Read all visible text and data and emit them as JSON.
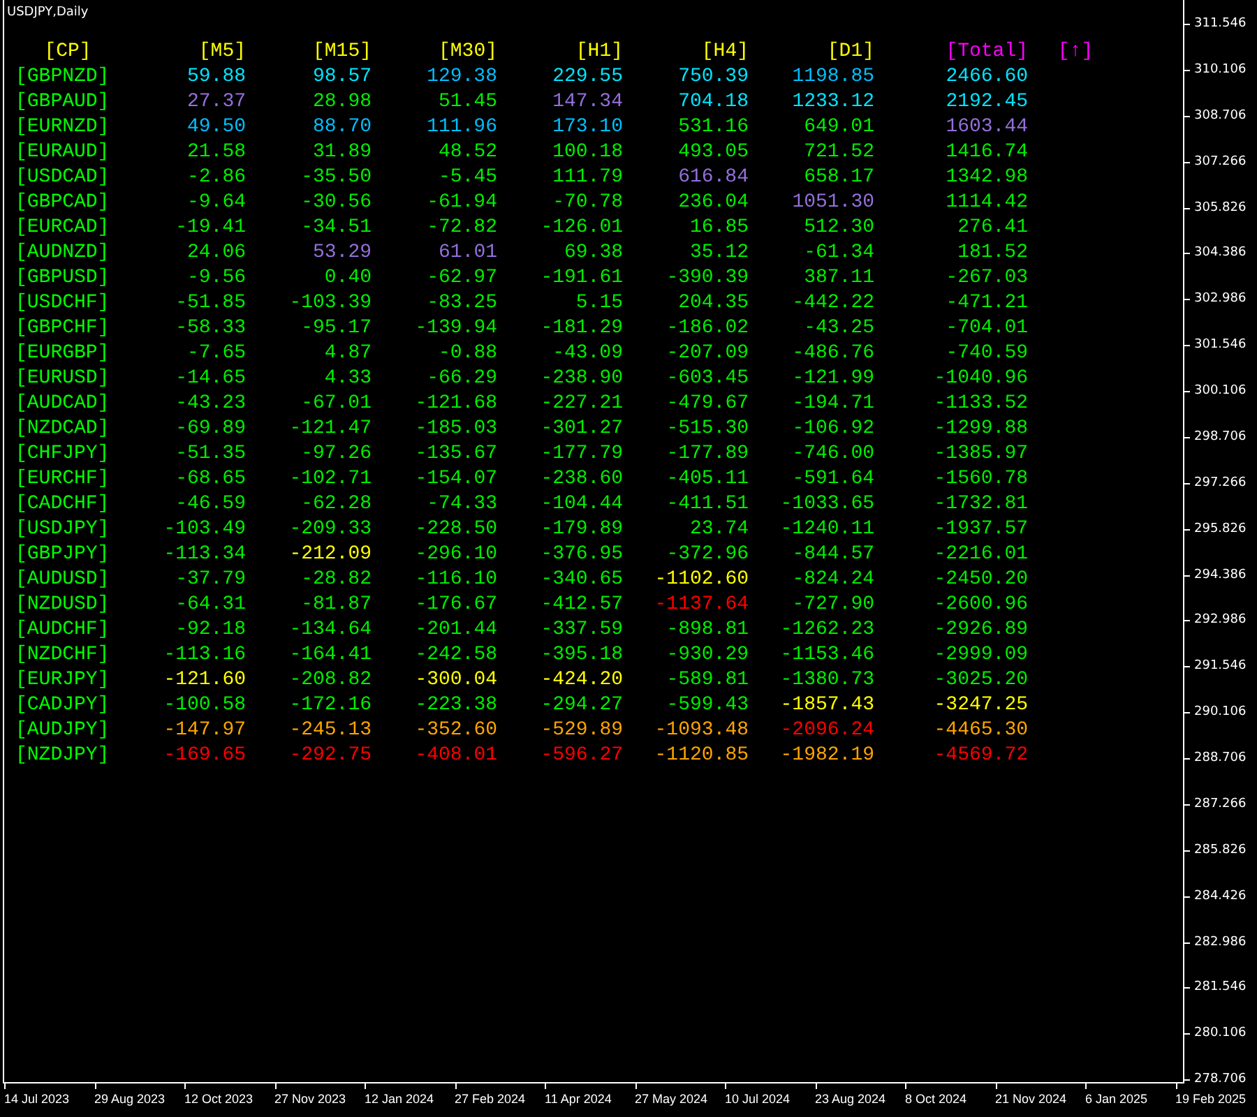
{
  "chart": {
    "title": "USDJPY,Daily"
  },
  "table": {
    "headers": [
      {
        "text": "[CP]",
        "color": "#ffff00"
      },
      {
        "text": "[M5]",
        "color": "#ffff00"
      },
      {
        "text": "[M15]",
        "color": "#ffff00"
      },
      {
        "text": "[M30]",
        "color": "#ffff00"
      },
      {
        "text": "[H1]",
        "color": "#ffff00"
      },
      {
        "text": "[H4]",
        "color": "#ffff00"
      },
      {
        "text": "[D1]",
        "color": "#ffff00"
      },
      {
        "text": "[Total]",
        "color": "#ff00ff"
      },
      {
        "text": "[↑]",
        "color": "#ff00ff"
      }
    ],
    "rows": [
      {
        "pair": "[GBPNZD]",
        "cells": [
          {
            "text": "59.88",
            "color": "#00e5ff"
          },
          {
            "text": "98.57",
            "color": "#00e5ff"
          },
          {
            "text": "129.38",
            "color": "#00bfff"
          },
          {
            "text": "229.55",
            "color": "#00e5ff"
          },
          {
            "text": "750.39",
            "color": "#00e5ff"
          },
          {
            "text": "1198.85",
            "color": "#00bfff"
          },
          {
            "text": "2466.60",
            "color": "#00e5ff"
          }
        ]
      },
      {
        "pair": "[GBPAUD]",
        "cells": [
          {
            "text": "27.37",
            "color": "#9370db"
          },
          {
            "text": "28.98",
            "color": "#00ee00"
          },
          {
            "text": "51.45",
            "color": "#00ee00"
          },
          {
            "text": "147.34",
            "color": "#9370db"
          },
          {
            "text": "704.18",
            "color": "#00e5ff"
          },
          {
            "text": "1233.12",
            "color": "#00e5ff"
          },
          {
            "text": "2192.45",
            "color": "#00e5ff"
          }
        ]
      },
      {
        "pair": "[EURNZD]",
        "cells": [
          {
            "text": "49.50",
            "color": "#00bfff"
          },
          {
            "text": "88.70",
            "color": "#00bfff"
          },
          {
            "text": "111.96",
            "color": "#00bfff"
          },
          {
            "text": "173.10",
            "color": "#00bfff"
          },
          {
            "text": "531.16",
            "color": "#00ee00"
          },
          {
            "text": "649.01",
            "color": "#00ee00"
          },
          {
            "text": "1603.44",
            "color": "#9370db"
          }
        ]
      },
      {
        "pair": "[EURAUD]",
        "cells": [
          {
            "text": "21.58",
            "color": "#00ee00"
          },
          {
            "text": "31.89",
            "color": "#00ee00"
          },
          {
            "text": "48.52",
            "color": "#00ee00"
          },
          {
            "text": "100.18",
            "color": "#00ee00"
          },
          {
            "text": "493.05",
            "color": "#00ee00"
          },
          {
            "text": "721.52",
            "color": "#00ee00"
          },
          {
            "text": "1416.74",
            "color": "#00ee00"
          }
        ]
      },
      {
        "pair": "[USDCAD]",
        "cells": [
          {
            "text": "-2.86",
            "color": "#00ee00"
          },
          {
            "text": "-35.50",
            "color": "#00ee00"
          },
          {
            "text": "-5.45",
            "color": "#00ee00"
          },
          {
            "text": "111.79",
            "color": "#00ee00"
          },
          {
            "text": "616.84",
            "color": "#9370db"
          },
          {
            "text": "658.17",
            "color": "#00ee00"
          },
          {
            "text": "1342.98",
            "color": "#00ee00"
          }
        ]
      },
      {
        "pair": "[GBPCAD]",
        "cells": [
          {
            "text": "-9.64",
            "color": "#00ee00"
          },
          {
            "text": "-30.56",
            "color": "#00ee00"
          },
          {
            "text": "-61.94",
            "color": "#00ee00"
          },
          {
            "text": "-70.78",
            "color": "#00ee00"
          },
          {
            "text": "236.04",
            "color": "#00ee00"
          },
          {
            "text": "1051.30",
            "color": "#9370db"
          },
          {
            "text": "1114.42",
            "color": "#00ee00"
          }
        ]
      },
      {
        "pair": "[EURCAD]",
        "cells": [
          {
            "text": "-19.41",
            "color": "#00ee00"
          },
          {
            "text": "-34.51",
            "color": "#00ee00"
          },
          {
            "text": "-72.82",
            "color": "#00ee00"
          },
          {
            "text": "-126.01",
            "color": "#00ee00"
          },
          {
            "text": "16.85",
            "color": "#00ee00"
          },
          {
            "text": "512.30",
            "color": "#00ee00"
          },
          {
            "text": "276.41",
            "color": "#00ee00"
          }
        ]
      },
      {
        "pair": "[AUDNZD]",
        "cells": [
          {
            "text": "24.06",
            "color": "#00ee00"
          },
          {
            "text": "53.29",
            "color": "#9370db"
          },
          {
            "text": "61.01",
            "color": "#9370db"
          },
          {
            "text": "69.38",
            "color": "#00ee00"
          },
          {
            "text": "35.12",
            "color": "#00ee00"
          },
          {
            "text": "-61.34",
            "color": "#00ee00"
          },
          {
            "text": "181.52",
            "color": "#00ee00"
          }
        ]
      },
      {
        "pair": "[GBPUSD]",
        "cells": [
          {
            "text": "-9.56",
            "color": "#00ee00"
          },
          {
            "text": "0.40",
            "color": "#00ee00"
          },
          {
            "text": "-62.97",
            "color": "#00ee00"
          },
          {
            "text": "-191.61",
            "color": "#00ee00"
          },
          {
            "text": "-390.39",
            "color": "#00ee00"
          },
          {
            "text": "387.11",
            "color": "#00ee00"
          },
          {
            "text": "-267.03",
            "color": "#00ee00"
          }
        ]
      },
      {
        "pair": "[USDCHF]",
        "cells": [
          {
            "text": "-51.85",
            "color": "#00ee00"
          },
          {
            "text": "-103.39",
            "color": "#00ee00"
          },
          {
            "text": "-83.25",
            "color": "#00ee00"
          },
          {
            "text": "5.15",
            "color": "#00ee00"
          },
          {
            "text": "204.35",
            "color": "#00ee00"
          },
          {
            "text": "-442.22",
            "color": "#00ee00"
          },
          {
            "text": "-471.21",
            "color": "#00ee00"
          }
        ]
      },
      {
        "pair": "[GBPCHF]",
        "cells": [
          {
            "text": "-58.33",
            "color": "#00ee00"
          },
          {
            "text": "-95.17",
            "color": "#00ee00"
          },
          {
            "text": "-139.94",
            "color": "#00ee00"
          },
          {
            "text": "-181.29",
            "color": "#00ee00"
          },
          {
            "text": "-186.02",
            "color": "#00ee00"
          },
          {
            "text": "-43.25",
            "color": "#00ee00"
          },
          {
            "text": "-704.01",
            "color": "#00ee00"
          }
        ]
      },
      {
        "pair": "[EURGBP]",
        "cells": [
          {
            "text": "-7.65",
            "color": "#00ee00"
          },
          {
            "text": "4.87",
            "color": "#00ee00"
          },
          {
            "text": "-0.88",
            "color": "#00ee00"
          },
          {
            "text": "-43.09",
            "color": "#00ee00"
          },
          {
            "text": "-207.09",
            "color": "#00ee00"
          },
          {
            "text": "-486.76",
            "color": "#00ee00"
          },
          {
            "text": "-740.59",
            "color": "#00ee00"
          }
        ]
      },
      {
        "pair": "[EURUSD]",
        "cells": [
          {
            "text": "-14.65",
            "color": "#00ee00"
          },
          {
            "text": "4.33",
            "color": "#00ee00"
          },
          {
            "text": "-66.29",
            "color": "#00ee00"
          },
          {
            "text": "-238.90",
            "color": "#00ee00"
          },
          {
            "text": "-603.45",
            "color": "#00ee00"
          },
          {
            "text": "-121.99",
            "color": "#00ee00"
          },
          {
            "text": "-1040.96",
            "color": "#00ee00"
          }
        ]
      },
      {
        "pair": "[AUDCAD]",
        "cells": [
          {
            "text": "-43.23",
            "color": "#00ee00"
          },
          {
            "text": "-67.01",
            "color": "#00ee00"
          },
          {
            "text": "-121.68",
            "color": "#00ee00"
          },
          {
            "text": "-227.21",
            "color": "#00ee00"
          },
          {
            "text": "-479.67",
            "color": "#00ee00"
          },
          {
            "text": "-194.71",
            "color": "#00ee00"
          },
          {
            "text": "-1133.52",
            "color": "#00ee00"
          }
        ]
      },
      {
        "pair": "[NZDCAD]",
        "cells": [
          {
            "text": "-69.89",
            "color": "#00ee00"
          },
          {
            "text": "-121.47",
            "color": "#00ee00"
          },
          {
            "text": "-185.03",
            "color": "#00ee00"
          },
          {
            "text": "-301.27",
            "color": "#00ee00"
          },
          {
            "text": "-515.30",
            "color": "#00ee00"
          },
          {
            "text": "-106.92",
            "color": "#00ee00"
          },
          {
            "text": "-1299.88",
            "color": "#00ee00"
          }
        ]
      },
      {
        "pair": "[CHFJPY]",
        "cells": [
          {
            "text": "-51.35",
            "color": "#00ee00"
          },
          {
            "text": "-97.26",
            "color": "#00ee00"
          },
          {
            "text": "-135.67",
            "color": "#00ee00"
          },
          {
            "text": "-177.79",
            "color": "#00ee00"
          },
          {
            "text": "-177.89",
            "color": "#00ee00"
          },
          {
            "text": "-746.00",
            "color": "#00ee00"
          },
          {
            "text": "-1385.97",
            "color": "#00ee00"
          }
        ]
      },
      {
        "pair": "[EURCHF]",
        "cells": [
          {
            "text": "-68.65",
            "color": "#00ee00"
          },
          {
            "text": "-102.71",
            "color": "#00ee00"
          },
          {
            "text": "-154.07",
            "color": "#00ee00"
          },
          {
            "text": "-238.60",
            "color": "#00ee00"
          },
          {
            "text": "-405.11",
            "color": "#00ee00"
          },
          {
            "text": "-591.64",
            "color": "#00ee00"
          },
          {
            "text": "-1560.78",
            "color": "#00ee00"
          }
        ]
      },
      {
        "pair": "[CADCHF]",
        "cells": [
          {
            "text": "-46.59",
            "color": "#00ee00"
          },
          {
            "text": "-62.28",
            "color": "#00ee00"
          },
          {
            "text": "-74.33",
            "color": "#00ee00"
          },
          {
            "text": "-104.44",
            "color": "#00ee00"
          },
          {
            "text": "-411.51",
            "color": "#00ee00"
          },
          {
            "text": "-1033.65",
            "color": "#00ee00"
          },
          {
            "text": "-1732.81",
            "color": "#00ee00"
          }
        ]
      },
      {
        "pair": "[USDJPY]",
        "cells": [
          {
            "text": "-103.49",
            "color": "#00ee00"
          },
          {
            "text": "-209.33",
            "color": "#00ee00"
          },
          {
            "text": "-228.50",
            "color": "#00ee00"
          },
          {
            "text": "-179.89",
            "color": "#00ee00"
          },
          {
            "text": "23.74",
            "color": "#00ee00"
          },
          {
            "text": "-1240.11",
            "color": "#00ee00"
          },
          {
            "text": "-1937.57",
            "color": "#00ee00"
          }
        ]
      },
      {
        "pair": "[GBPJPY]",
        "cells": [
          {
            "text": "-113.34",
            "color": "#00ee00"
          },
          {
            "text": "-212.09",
            "color": "#ffff00"
          },
          {
            "text": "-296.10",
            "color": "#00ee00"
          },
          {
            "text": "-376.95",
            "color": "#00ee00"
          },
          {
            "text": "-372.96",
            "color": "#00ee00"
          },
          {
            "text": "-844.57",
            "color": "#00ee00"
          },
          {
            "text": "-2216.01",
            "color": "#00ee00"
          }
        ]
      },
      {
        "pair": "[AUDUSD]",
        "cells": [
          {
            "text": "-37.79",
            "color": "#00ee00"
          },
          {
            "text": "-28.82",
            "color": "#00ee00"
          },
          {
            "text": "-116.10",
            "color": "#00ee00"
          },
          {
            "text": "-340.65",
            "color": "#00ee00"
          },
          {
            "text": "-1102.60",
            "color": "#ffff00"
          },
          {
            "text": "-824.24",
            "color": "#00ee00"
          },
          {
            "text": "-2450.20",
            "color": "#00ee00"
          }
        ]
      },
      {
        "pair": "[NZDUSD]",
        "cells": [
          {
            "text": "-64.31",
            "color": "#00ee00"
          },
          {
            "text": "-81.87",
            "color": "#00ee00"
          },
          {
            "text": "-176.67",
            "color": "#00ee00"
          },
          {
            "text": "-412.57",
            "color": "#00ee00"
          },
          {
            "text": "-1137.64",
            "color": "#ff0000"
          },
          {
            "text": "-727.90",
            "color": "#00ee00"
          },
          {
            "text": "-2600.96",
            "color": "#00ee00"
          }
        ]
      },
      {
        "pair": "[AUDCHF]",
        "cells": [
          {
            "text": "-92.18",
            "color": "#00ee00"
          },
          {
            "text": "-134.64",
            "color": "#00ee00"
          },
          {
            "text": "-201.44",
            "color": "#00ee00"
          },
          {
            "text": "-337.59",
            "color": "#00ee00"
          },
          {
            "text": "-898.81",
            "color": "#00ee00"
          },
          {
            "text": "-1262.23",
            "color": "#00ee00"
          },
          {
            "text": "-2926.89",
            "color": "#00ee00"
          }
        ]
      },
      {
        "pair": "[NZDCHF]",
        "cells": [
          {
            "text": "-113.16",
            "color": "#00ee00"
          },
          {
            "text": "-164.41",
            "color": "#00ee00"
          },
          {
            "text": "-242.58",
            "color": "#00ee00"
          },
          {
            "text": "-395.18",
            "color": "#00ee00"
          },
          {
            "text": "-930.29",
            "color": "#00ee00"
          },
          {
            "text": "-1153.46",
            "color": "#00ee00"
          },
          {
            "text": "-2999.09",
            "color": "#00ee00"
          }
        ]
      },
      {
        "pair": "[EURJPY]",
        "cells": [
          {
            "text": "-121.60",
            "color": "#ffff00"
          },
          {
            "text": "-208.82",
            "color": "#00ee00"
          },
          {
            "text": "-300.04",
            "color": "#ffff00"
          },
          {
            "text": "-424.20",
            "color": "#ffff00"
          },
          {
            "text": "-589.81",
            "color": "#00ee00"
          },
          {
            "text": "-1380.73",
            "color": "#00ee00"
          },
          {
            "text": "-3025.20",
            "color": "#00ee00"
          }
        ]
      },
      {
        "pair": "[CADJPY]",
        "cells": [
          {
            "text": "-100.58",
            "color": "#00ee00"
          },
          {
            "text": "-172.16",
            "color": "#00ee00"
          },
          {
            "text": "-223.38",
            "color": "#00ee00"
          },
          {
            "text": "-294.27",
            "color": "#00ee00"
          },
          {
            "text": "-599.43",
            "color": "#00ee00"
          },
          {
            "text": "-1857.43",
            "color": "#ffff00"
          },
          {
            "text": "-3247.25",
            "color": "#ffff00"
          }
        ]
      },
      {
        "pair": "[AUDJPY]",
        "cells": [
          {
            "text": "-147.97",
            "color": "#ffa500"
          },
          {
            "text": "-245.13",
            "color": "#ffa500"
          },
          {
            "text": "-352.60",
            "color": "#ffa500"
          },
          {
            "text": "-529.89",
            "color": "#ffa500"
          },
          {
            "text": "-1093.48",
            "color": "#ffa500"
          },
          {
            "text": "-2096.24",
            "color": "#ff0000"
          },
          {
            "text": "-4465.30",
            "color": "#ffa500"
          }
        ]
      },
      {
        "pair": "[NZDJPY]",
        "cells": [
          {
            "text": "-169.65",
            "color": "#ff0000"
          },
          {
            "text": "-292.75",
            "color": "#ff0000"
          },
          {
            "text": "-408.01",
            "color": "#ff0000"
          },
          {
            "text": "-596.27",
            "color": "#ff0000"
          },
          {
            "text": "-1120.85",
            "color": "#ffa500"
          },
          {
            "text": "-1982.19",
            "color": "#ffa500"
          },
          {
            "text": "-4569.72",
            "color": "#ff0000"
          }
        ]
      }
    ]
  },
  "price_axis": [
    "311.546",
    "310.106",
    "308.706",
    "307.266",
    "305.826",
    "304.386",
    "302.986",
    "301.546",
    "300.106",
    "298.706",
    "297.266",
    "295.826",
    "294.386",
    "292.986",
    "291.546",
    "290.106",
    "288.706",
    "287.266",
    "285.826",
    "284.426",
    "282.986",
    "281.546",
    "280.106",
    "278.706"
  ],
  "time_axis": [
    "14 Jul 2023",
    "29 Aug 2023",
    "12 Oct 2023",
    "27 Nov 2023",
    "12 Jan 2024",
    "27 Feb 2024",
    "11 Apr 2024",
    "27 May 2024",
    "10 Jul 2024",
    "23 Aug 2024",
    "8 Oct 2024",
    "21 Nov 2024",
    "6 Jan 2025",
    "19 Feb 2025"
  ]
}
